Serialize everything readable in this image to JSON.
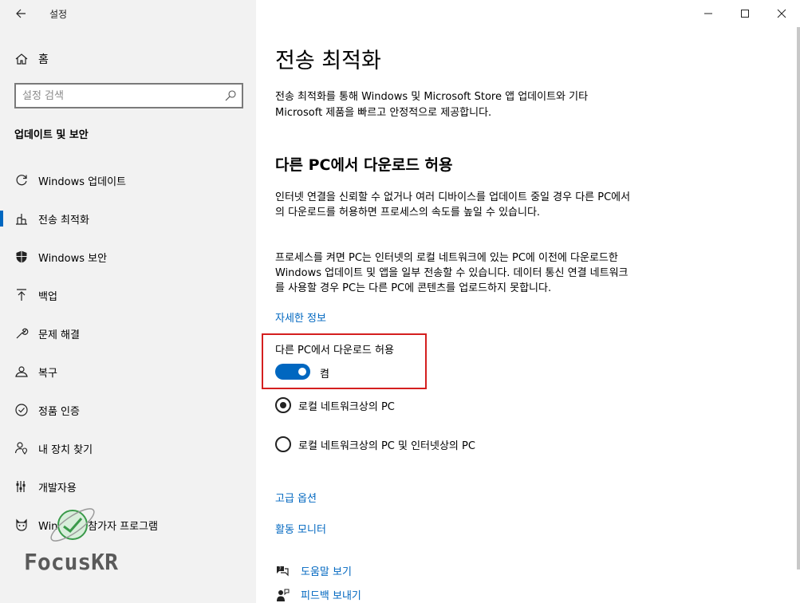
{
  "window": {
    "title": "설정",
    "controls": [
      "minimize",
      "maximize",
      "close"
    ]
  },
  "sidebar": {
    "home_label": "홈",
    "search_placeholder": "설정 검색",
    "section_heading": "업데이트 및 보안",
    "items": [
      {
        "label": "Windows 업데이트",
        "icon": "refresh-icon"
      },
      {
        "label": "전송 최적화",
        "icon": "delivery-optimization-icon",
        "active": true
      },
      {
        "label": "Windows 보안",
        "icon": "shield-icon"
      },
      {
        "label": "백업",
        "icon": "backup-arrow-icon"
      },
      {
        "label": "문제 해결",
        "icon": "wrench-icon"
      },
      {
        "label": "복구",
        "icon": "recovery-icon"
      },
      {
        "label": "정품 인증",
        "icon": "check-circle-icon"
      },
      {
        "label": "내 장치 찾기",
        "icon": "person-location-icon"
      },
      {
        "label": "개발자용",
        "icon": "developer-tools-icon"
      },
      {
        "label": "Windows 참가자 프로그램",
        "icon": "insider-cat-icon"
      }
    ],
    "watermark_text": "FocusKR"
  },
  "main": {
    "title": "전송 최적화",
    "description": "전송 최적화를 통해 Windows 및 Microsoft Store 앱 업데이트와 기타 Microsoft 제품을 빠르고 안정적으로 제공합니다.",
    "subheading": "다른 PC에서 다운로드 허용",
    "paragraph1": "인터넷 연결을 신뢰할 수 없거나 여러 디바이스를 업데이트 중일 경우 다른 PC에서의 다운로드를 허용하면 프로세스의 속도를 높일 수 있습니다.",
    "paragraph2": "프로세스를 켜면 PC는 인터넷의 로컬 네트워크에 있는 PC에 이전에 다운로드한 Windows 업데이트 및 앱을 일부 전송할 수 있습니다. 데이터 통신 연결 네트워크를 사용할 경우 PC는 다른 PC에 콘텐츠를 업로드하지 못합니다.",
    "learn_more": "자세한 정보",
    "toggle": {
      "label": "다른 PC에서 다운로드 허용",
      "state_text": "켬",
      "on": true
    },
    "radio_options": [
      {
        "label": "로컬 네트워크상의 PC",
        "checked": true
      },
      {
        "label": "로컬 네트워크상의 PC 및 인터넷상의 PC",
        "checked": false
      }
    ],
    "links": {
      "advanced": "고급 옵션",
      "monitor": "활동 모니터"
    },
    "help": {
      "get_help": "도움말 보기",
      "feedback": "피드백 보내기"
    }
  },
  "colors": {
    "accent": "#0067c0",
    "sidebar_bg": "#f2f2f2",
    "highlight_border": "#d41f1f"
  }
}
